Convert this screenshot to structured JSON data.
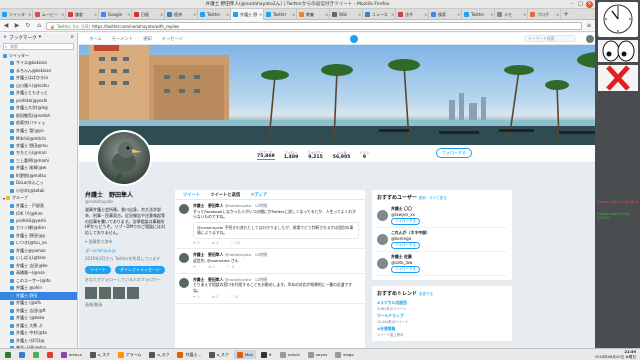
{
  "window": {
    "title": "弁護士 野田隼人(@nodahayato2ん) | Twitterからの返信付きツイート - Mozilla Firefox"
  },
  "tabs": [
    {
      "label": "ツイッター",
      "color": "#1da1f2"
    },
    {
      "label": "ムービー",
      "color": "#e04a4a"
    },
    {
      "label": "鎌倉",
      "color": "#d73a3a"
    },
    {
      "label": "Google",
      "color": "#4285f4"
    },
    {
      "label": "日経",
      "color": "#d32f2f"
    },
    {
      "label": "経済",
      "color": "#3b82c4"
    },
    {
      "label": "Twitter",
      "color": "#1da1f2"
    },
    {
      "label": "弁護士 野",
      "color": "#1da1f2"
    },
    {
      "label": "Twitter",
      "color": "#1da1f2"
    },
    {
      "label": "教養",
      "color": "#e0843a"
    },
    {
      "label": "Wiki",
      "color": "#666666"
    },
    {
      "label": "ニュース",
      "color": "#3b82c4"
    },
    {
      "label": "法令",
      "color": "#d73a3a"
    },
    {
      "label": "検索",
      "color": "#4285f4"
    },
    {
      "label": "Twitter",
      "color": "#1da1f2"
    },
    {
      "label": "メモ",
      "color": "#8a8a8a"
    },
    {
      "label": "ブログ",
      "color": "#e06c3a"
    }
  ],
  "nav": {
    "url_prefix": "Twitter, Inc. (US)",
    "url": "https://twitter.com/nodahayato/with_replies"
  },
  "sidebar": {
    "title": "ブックマーク",
    "search_placeholder": "検索",
    "items": [
      {
        "label": "ツイッター",
        "indent": 0,
        "folder": false,
        "sel": false
      },
      {
        "label": "サイエ@kokisan",
        "indent": 1,
        "folder": false,
        "sel": false
      },
      {
        "label": "まろんん@kokisan",
        "indent": 1,
        "folder": false,
        "sel": false
      },
      {
        "label": "弁護士はばひろ(a",
        "indent": 1,
        "folder": false,
        "sel": false
      },
      {
        "label": "山川雅人(@tochu",
        "indent": 1,
        "folder": false,
        "sel": false
      },
      {
        "label": "弁護士ともきっと",
        "indent": 1,
        "folder": false,
        "sel": false
      },
      {
        "label": "yoshiko(@yoshi",
        "indent": 1,
        "folder": false,
        "sel": false
      },
      {
        "label": "弁護士大学(@leg",
        "indent": 1,
        "folder": false,
        "sel": false
      },
      {
        "label": "前田敬吾(@nodah",
        "indent": 1,
        "folder": false,
        "sel": false
      },
      {
        "label": "前東京(バティェ",
        "indent": 1,
        "folder": false,
        "sel": false
      },
      {
        "label": "弁護士 管(@yo",
        "indent": 1,
        "folder": false,
        "sel": false
      },
      {
        "label": "Mitchi(@mitchi",
        "indent": 1,
        "folder": false,
        "sel": false
      },
      {
        "label": "弁護士 野田@mu",
        "indent": 1,
        "folder": false,
        "sel": false
      },
      {
        "label": "ちちとら(@mari",
        "indent": 1,
        "folder": false,
        "sel": false
      },
      {
        "label": "三上重明(@mami",
        "indent": 1,
        "folder": false,
        "sel": false
      },
      {
        "label": "弁護士 尾崎(@w",
        "indent": 1,
        "folder": false,
        "sel": false
      },
      {
        "label": "町野航(@matsu",
        "indent": 1,
        "folder": false,
        "sel": false
      },
      {
        "label": "DoLa(ゆんこっ",
        "indent": 1,
        "folder": false,
        "sel": false
      },
      {
        "label": "小谷木(@kotak",
        "indent": 1,
        "folder": false,
        "sel": false
      },
      {
        "label": "グループ",
        "indent": 0,
        "folder": true,
        "sel": false
      },
      {
        "label": "弁護士・戸部直",
        "indent": 1,
        "folder": false,
        "sel": false
      },
      {
        "label": "(OK !)!(@hiro",
        "indent": 1,
        "folder": false,
        "sel": false
      },
      {
        "label": "yoshiki(@yoshi",
        "indent": 1,
        "folder": false,
        "sel": false
      },
      {
        "label": "カリン様(@disn",
        "indent": 1,
        "folder": false,
        "sel": false
      },
      {
        "label": "弁護士 野田(@y",
        "indent": 1,
        "folder": false,
        "sel": false
      },
      {
        "label": "いつき(@tsu_na",
        "indent": 1,
        "folder": false,
        "sel": false
      },
      {
        "label": "弁護士@yamao",
        "indent": 1,
        "folder": false,
        "sel": false
      },
      {
        "label": "いしばえ(@taro",
        "indent": 1,
        "folder": false,
        "sel": false
      },
      {
        "label": "弁護士 吉田(@ke",
        "indent": 1,
        "folder": false,
        "sel": false
      },
      {
        "label": "高橋隆一(@nsa",
        "indent": 1,
        "folder": false,
        "sel": false
      },
      {
        "label": "このユーザー(@ito",
        "indent": 1,
        "folder": false,
        "sel": false
      },
      {
        "label": "弁護士 @ohin",
        "indent": 1,
        "folder": false,
        "sel": false
      },
      {
        "label": "弁護士 野田",
        "indent": 1,
        "folder": false,
        "sel": true
      },
      {
        "label": "弁護士 (@a%",
        "indent": 1,
        "folder": false,
        "sel": false
      },
      {
        "label": "弁護士 吉田(@ft",
        "indent": 1,
        "folder": false,
        "sel": false
      },
      {
        "label": "弁護士 (@koka",
        "indent": 1,
        "folder": false,
        "sel": false
      },
      {
        "label": "弁護士 大熊 ぷ",
        "indent": 1,
        "folder": false,
        "sel": false
      },
      {
        "label": "弁護士 中村(@ta",
        "indent": 1,
        "folder": false,
        "sel": false
      },
      {
        "label": "弁護士 (伴可(@",
        "indent": 1,
        "folder": false,
        "sel": false
      },
      {
        "label": "義浩 山田(@dsa",
        "indent": 1,
        "folder": false,
        "sel": false
      },
      {
        "label": "弁護士 (本日)",
        "indent": 1,
        "folder": false,
        "sel": false
      }
    ]
  },
  "twitter": {
    "nav_home": "ホーム",
    "nav_moments": "モーメント",
    "nav_notifications": "通知",
    "nav_messages": "メッセージ",
    "search_placeholder": "キーワード検索",
    "tweet_button": "ツイート",
    "stats": [
      {
        "label": "ツイート",
        "value": "75,869"
      },
      {
        "label": "フォロー",
        "value": "1,489"
      },
      {
        "label": "フォロワー",
        "value": "9,215"
      },
      {
        "label": "いいね",
        "value": "56,905"
      },
      {
        "label": "リスト",
        "value": "9"
      }
    ],
    "follow_label": "フォローする",
    "profile": {
      "name": "弁護士　野田隼人",
      "handle": "@nodahayato",
      "bio": "滋賀弁護士会所属。香川出身。京大法学部卒、刑事・民事双方。近況報告や注意喚起等の記事を書いております。法律相談は事務所HPからどうぞ。リプ・DMでのご相談には対応しておりません。",
      "location": "滋賀県大津市",
      "link": "nodahaya.jp",
      "joined": "2010年3月から Twitterを利用しています",
      "btn_tweet": "ツイート",
      "btn_message": "ダイレクトメッセージ",
      "followers_you_know": "あなたがフォローしている人のフォロワー",
      "media_label": "画像/動画"
    },
    "tl_tabs": [
      "ツイート",
      "ツイートと返信",
      "メディア"
    ],
    "tweets": [
      {
        "name": "弁護士　野田隼人",
        "meta": "@nodahayato · 12時間",
        "text": "ずっとFacebookしなかった人がいつの間にかTwitterに詳しくなってるとか、人生ってよくわからないものですね。",
        "quote": "@nodahayato 手続きの流れとしては分かりましたが、現場でどう判断されるかは個別の事情によりますね。",
        "acts": [
          "1",
          "4",
          "22"
        ]
      },
      {
        "name": "弁護士　野田隼人",
        "meta": "@nodahayato · 12時間",
        "text": "返信先: @username さん",
        "quote": "",
        "acts": [
          "",
          "1",
          "3"
        ]
      },
      {
        "name": "弁護士　野田隼人",
        "meta": "@nodahayato · 12時間",
        "text": "とりあえず相談の窓口を利用することをお勧めします。早めの対応が結果的に一番の近道ですね。",
        "quote": "",
        "acts": [
          "1",
          "2",
          "9"
        ]
      }
    ],
    "who_to_follow": {
      "title": "おすすめユーザー",
      "refresh": "更新 · すべて見る",
      "users": [
        {
          "name": "弁護士 〇〇",
          "handle": "@lawyer_xx"
        },
        {
          "name": "これんが（ネネ中部）",
          "handle": "@korenga"
        },
        {
          "name": "弁護士 佐藤",
          "handle": "@sato_law"
        }
      ],
      "follow_btn": "フォローする"
    },
    "trends": {
      "title": "おすすめトレンド",
      "change": "変更する",
      "items": [
        {
          "tag": "#ユヅカル応援団",
          "sub": "3,562件のツイート"
        },
        {
          "tag": "ワールドカップ",
          "sub": "12,400件のツイート"
        },
        {
          "tag": "#台風情報",
          "sub": "ツイート急上昇中"
        }
      ]
    }
  },
  "right_panel": {
    "text1": "Sweat-add-mysql-utf-8",
    "text2": "Firefox-app-2018y-2018m"
  },
  "taskbar": {
    "items": [
      {
        "label": "",
        "color": "#3a7bd5"
      },
      {
        "label": "",
        "color": "#4caf50"
      },
      {
        "label": "",
        "color": "#e53935"
      },
      {
        "label": "emacs",
        "color": "#8e44ad"
      },
      {
        "label": "a_スク",
        "color": "#555555"
      },
      {
        "label": "アラーム",
        "color": "#ff9800"
      },
      {
        "label": "a_スク",
        "color": "#555555"
      },
      {
        "label": "弁護士...",
        "color": "#e66000"
      },
      {
        "label": "a_スク",
        "color": "#555555"
      },
      {
        "label": "Moz",
        "color": "#e66000"
      },
      {
        "label": "ft",
        "color": "#333333"
      },
      {
        "label": "xclock",
        "color": "#999999"
      },
      {
        "label": "xeyes",
        "color": "#999999"
      },
      {
        "label": "xlogo",
        "color": "#999999"
      }
    ],
    "time": "21:59",
    "date": "2018年06月20日 木曜日"
  }
}
